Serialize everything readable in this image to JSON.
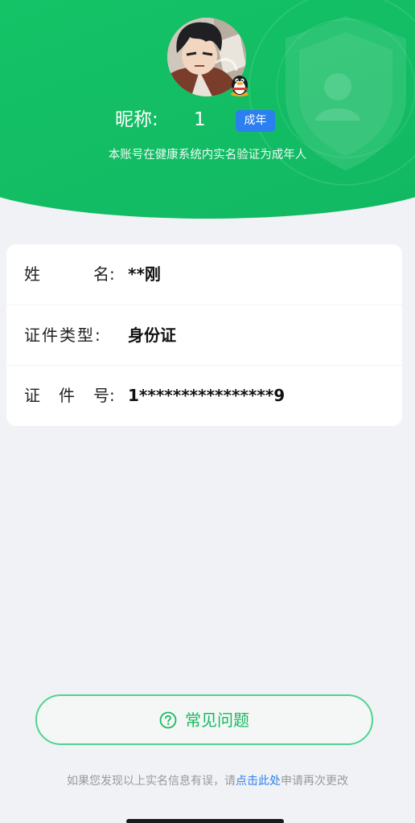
{
  "colors": {
    "brand_green": "#16c267",
    "badge_blue": "#2b7ff0",
    "page_bg": "#f0f2f5",
    "link_blue": "#2b7ff0"
  },
  "profile": {
    "nickname_label": "昵称:",
    "nickname_value": "1",
    "age_badge": "成年",
    "avatar_icon": "avatar-photo",
    "platform_icon": "qq-penguin-icon",
    "verify_note": "本账号在健康系统内实名验证为成年人"
  },
  "info": {
    "rows": [
      {
        "label_chars": [
          "姓",
          "名:"
        ],
        "value": "**刚"
      },
      {
        "label_chars": [
          "证件类型:"
        ],
        "value": "身份证"
      },
      {
        "label_chars": [
          "证",
          "件",
          "号:"
        ],
        "value": "1****************9"
      }
    ]
  },
  "faq": {
    "label": "常见问题",
    "icon": "question-circle-icon"
  },
  "footer": {
    "prefix": "如果您发现以上实名信息有误，请",
    "link": "点击此处",
    "suffix": "申请再次更改"
  }
}
